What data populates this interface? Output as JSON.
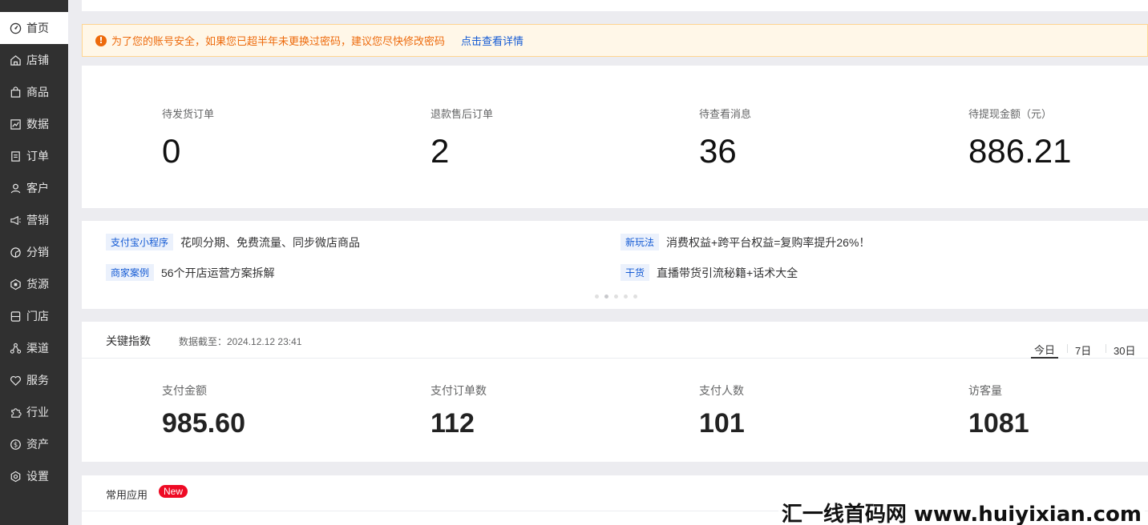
{
  "sidebar": {
    "items": [
      {
        "label": "首页",
        "icon": "home-dashboard-icon",
        "active": true
      },
      {
        "label": "店铺",
        "icon": "store-icon"
      },
      {
        "label": "商品",
        "icon": "shopping-bag-icon"
      },
      {
        "label": "数据",
        "icon": "chart-icon"
      },
      {
        "label": "订单",
        "icon": "order-icon"
      },
      {
        "label": "客户",
        "icon": "user-icon"
      },
      {
        "label": "营销",
        "icon": "megaphone-icon"
      },
      {
        "label": "分销",
        "icon": "distribution-icon"
      },
      {
        "label": "货源",
        "icon": "supply-icon"
      },
      {
        "label": "门店",
        "icon": "shop-door-icon"
      },
      {
        "label": "渠道",
        "icon": "channel-icon"
      },
      {
        "label": "服务",
        "icon": "heart-icon"
      },
      {
        "label": "行业",
        "icon": "puzzle-icon"
      },
      {
        "label": "资产",
        "icon": "dollar-icon"
      },
      {
        "label": "设置",
        "icon": "settings-icon"
      }
    ]
  },
  "notice": {
    "message": "为了您的账号安全，如果您已超半年未更换过密码，建议您尽快修改密码",
    "link": "点击查看详情",
    "color": "#ed6a0c"
  },
  "overview": [
    {
      "label": "待发货订单",
      "value": "0"
    },
    {
      "label": "退款售后订单",
      "value": "2"
    },
    {
      "label": "待查看消息",
      "value": "36"
    },
    {
      "label": "待提现金额（元）",
      "value": "886.21"
    }
  ],
  "promos": [
    {
      "tag": "支付宝小程序",
      "text": "花呗分期、免费流量、同步微店商品"
    },
    {
      "tag": "新玩法",
      "text": "消费权益+跨平台权益=复购率提升26%！"
    },
    {
      "tag": "商家案例",
      "text": "56个开店运营方案拆解"
    },
    {
      "tag": "干货",
      "text": "直播带货引流秘籍+话术大全"
    }
  ],
  "carousel": {
    "count": 5,
    "active_index": 1
  },
  "key_metrics": {
    "title": "关键指数",
    "date": "数据截至：2024.12.12 23:41",
    "ranges": [
      "今日",
      "7日",
      "30日"
    ],
    "active_range": "今日",
    "items": [
      {
        "label": "支付金额",
        "value": "985.60"
      },
      {
        "label": "支付订单数",
        "value": "112"
      },
      {
        "label": "支付人数",
        "value": "101"
      },
      {
        "label": "访客量",
        "value": "1081"
      }
    ]
  },
  "apps": {
    "title": "常用应用",
    "badge": "New"
  },
  "watermark": "汇一线首码网 www.huiyixian.com"
}
